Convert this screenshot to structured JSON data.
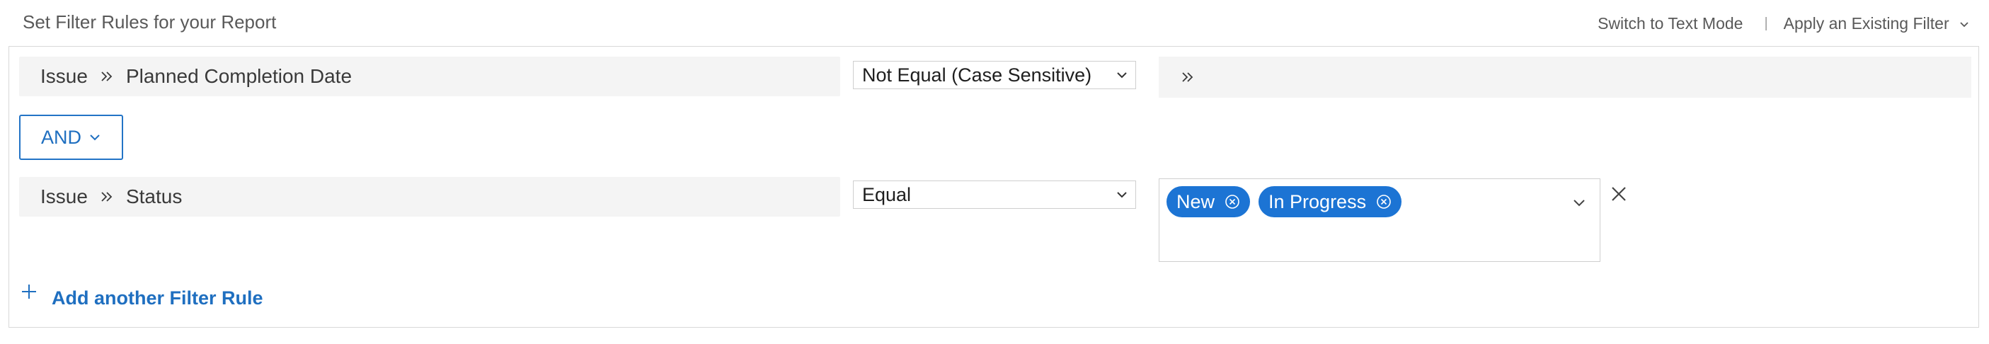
{
  "header": {
    "title": "Set Filter Rules for your Report",
    "switch_link": "Switch to Text Mode",
    "separator": "|",
    "apply_link": "Apply an Existing Filter"
  },
  "rules": [
    {
      "field": {
        "object": "Issue",
        "name": "Planned Completion Date"
      },
      "operator": "Not Equal (Case Sensitive)"
    },
    {
      "field": {
        "object": "Issue",
        "name": "Status"
      },
      "operator": "Equal",
      "values": [
        "New",
        "In Progress"
      ]
    }
  ],
  "conjunction": "AND",
  "add_rule_label": "Add another Filter Rule",
  "icons": {
    "field_separator": "double-chevron-right-icon",
    "dropdown": "chevron-down-icon",
    "chip_remove": "circle-x-icon",
    "remove_rule": "close-icon",
    "add": "plus-icon"
  },
  "colors": {
    "accent": "#1c74d4",
    "link": "#1f6fc0",
    "field_bg": "#f4f4f4"
  }
}
